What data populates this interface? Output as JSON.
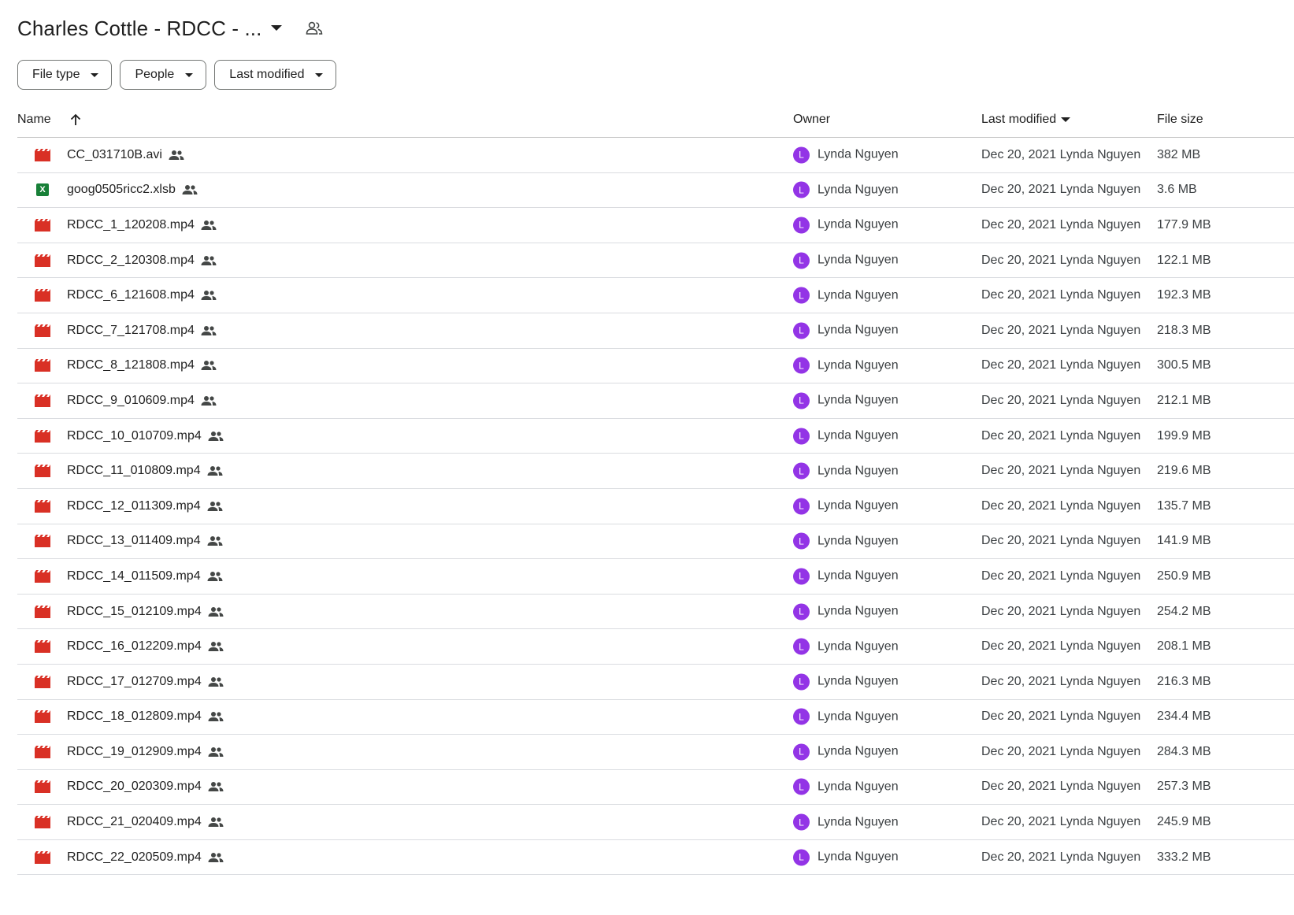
{
  "header": {
    "title": "Charles Cottle - RDCC - ...",
    "caret_icon": "arrow-drop-down-icon",
    "shared_icon": "shared-folder-icon"
  },
  "filters": [
    {
      "label": "File type"
    },
    {
      "label": "People"
    },
    {
      "label": "Last modified"
    }
  ],
  "table": {
    "columns": {
      "name": "Name",
      "owner": "Owner",
      "modified": "Last modified",
      "size": "File size"
    },
    "rows": [
      {
        "name": "CC_031710B.avi",
        "type": "video",
        "owner_initial": "L",
        "owner": "Lynda Nguyen",
        "modified": "Dec 20, 2021 Lynda Nguyen",
        "size": "382 MB"
      },
      {
        "name": "goog0505ricc2.xlsb",
        "type": "excel",
        "owner_initial": "L",
        "owner": "Lynda Nguyen",
        "modified": "Dec 20, 2021 Lynda Nguyen",
        "size": "3.6 MB"
      },
      {
        "name": "RDCC_1_120208.mp4",
        "type": "video",
        "owner_initial": "L",
        "owner": "Lynda Nguyen",
        "modified": "Dec 20, 2021 Lynda Nguyen",
        "size": "177.9 MB"
      },
      {
        "name": "RDCC_2_120308.mp4",
        "type": "video",
        "owner_initial": "L",
        "owner": "Lynda Nguyen",
        "modified": "Dec 20, 2021 Lynda Nguyen",
        "size": "122.1 MB"
      },
      {
        "name": "RDCC_6_121608.mp4",
        "type": "video",
        "owner_initial": "L",
        "owner": "Lynda Nguyen",
        "modified": "Dec 20, 2021 Lynda Nguyen",
        "size": "192.3 MB"
      },
      {
        "name": "RDCC_7_121708.mp4",
        "type": "video",
        "owner_initial": "L",
        "owner": "Lynda Nguyen",
        "modified": "Dec 20, 2021 Lynda Nguyen",
        "size": "218.3 MB"
      },
      {
        "name": "RDCC_8_121808.mp4",
        "type": "video",
        "owner_initial": "L",
        "owner": "Lynda Nguyen",
        "modified": "Dec 20, 2021 Lynda Nguyen",
        "size": "300.5 MB"
      },
      {
        "name": "RDCC_9_010609.mp4",
        "type": "video",
        "owner_initial": "L",
        "owner": "Lynda Nguyen",
        "modified": "Dec 20, 2021 Lynda Nguyen",
        "size": "212.1 MB"
      },
      {
        "name": "RDCC_10_010709.mp4",
        "type": "video",
        "owner_initial": "L",
        "owner": "Lynda Nguyen",
        "modified": "Dec 20, 2021 Lynda Nguyen",
        "size": "199.9 MB"
      },
      {
        "name": "RDCC_11_010809.mp4",
        "type": "video",
        "owner_initial": "L",
        "owner": "Lynda Nguyen",
        "modified": "Dec 20, 2021 Lynda Nguyen",
        "size": "219.6 MB"
      },
      {
        "name": "RDCC_12_011309.mp4",
        "type": "video",
        "owner_initial": "L",
        "owner": "Lynda Nguyen",
        "modified": "Dec 20, 2021 Lynda Nguyen",
        "size": "135.7 MB"
      },
      {
        "name": "RDCC_13_011409.mp4",
        "type": "video",
        "owner_initial": "L",
        "owner": "Lynda Nguyen",
        "modified": "Dec 20, 2021 Lynda Nguyen",
        "size": "141.9 MB"
      },
      {
        "name": "RDCC_14_011509.mp4",
        "type": "video",
        "owner_initial": "L",
        "owner": "Lynda Nguyen",
        "modified": "Dec 20, 2021 Lynda Nguyen",
        "size": "250.9 MB"
      },
      {
        "name": "RDCC_15_012109.mp4",
        "type": "video",
        "owner_initial": "L",
        "owner": "Lynda Nguyen",
        "modified": "Dec 20, 2021 Lynda Nguyen",
        "size": "254.2 MB"
      },
      {
        "name": "RDCC_16_012209.mp4",
        "type": "video",
        "owner_initial": "L",
        "owner": "Lynda Nguyen",
        "modified": "Dec 20, 2021 Lynda Nguyen",
        "size": "208.1 MB"
      },
      {
        "name": "RDCC_17_012709.mp4",
        "type": "video",
        "owner_initial": "L",
        "owner": "Lynda Nguyen",
        "modified": "Dec 20, 2021 Lynda Nguyen",
        "size": "216.3 MB"
      },
      {
        "name": "RDCC_18_012809.mp4",
        "type": "video",
        "owner_initial": "L",
        "owner": "Lynda Nguyen",
        "modified": "Dec 20, 2021 Lynda Nguyen",
        "size": "234.4 MB"
      },
      {
        "name": "RDCC_19_012909.mp4",
        "type": "video",
        "owner_initial": "L",
        "owner": "Lynda Nguyen",
        "modified": "Dec 20, 2021 Lynda Nguyen",
        "size": "284.3 MB"
      },
      {
        "name": "RDCC_20_020309.mp4",
        "type": "video",
        "owner_initial": "L",
        "owner": "Lynda Nguyen",
        "modified": "Dec 20, 2021 Lynda Nguyen",
        "size": "257.3 MB"
      },
      {
        "name": "RDCC_21_020409.mp4",
        "type": "video",
        "owner_initial": "L",
        "owner": "Lynda Nguyen",
        "modified": "Dec 20, 2021 Lynda Nguyen",
        "size": "245.9 MB"
      },
      {
        "name": "RDCC_22_020509.mp4",
        "type": "video",
        "owner_initial": "L",
        "owner": "Lynda Nguyen",
        "modified": "Dec 20, 2021 Lynda Nguyen",
        "size": "333.2 MB"
      }
    ]
  },
  "colors": {
    "video_icon": "#d93025",
    "excel_icon": "#188038",
    "avatar": "#9334e6"
  }
}
